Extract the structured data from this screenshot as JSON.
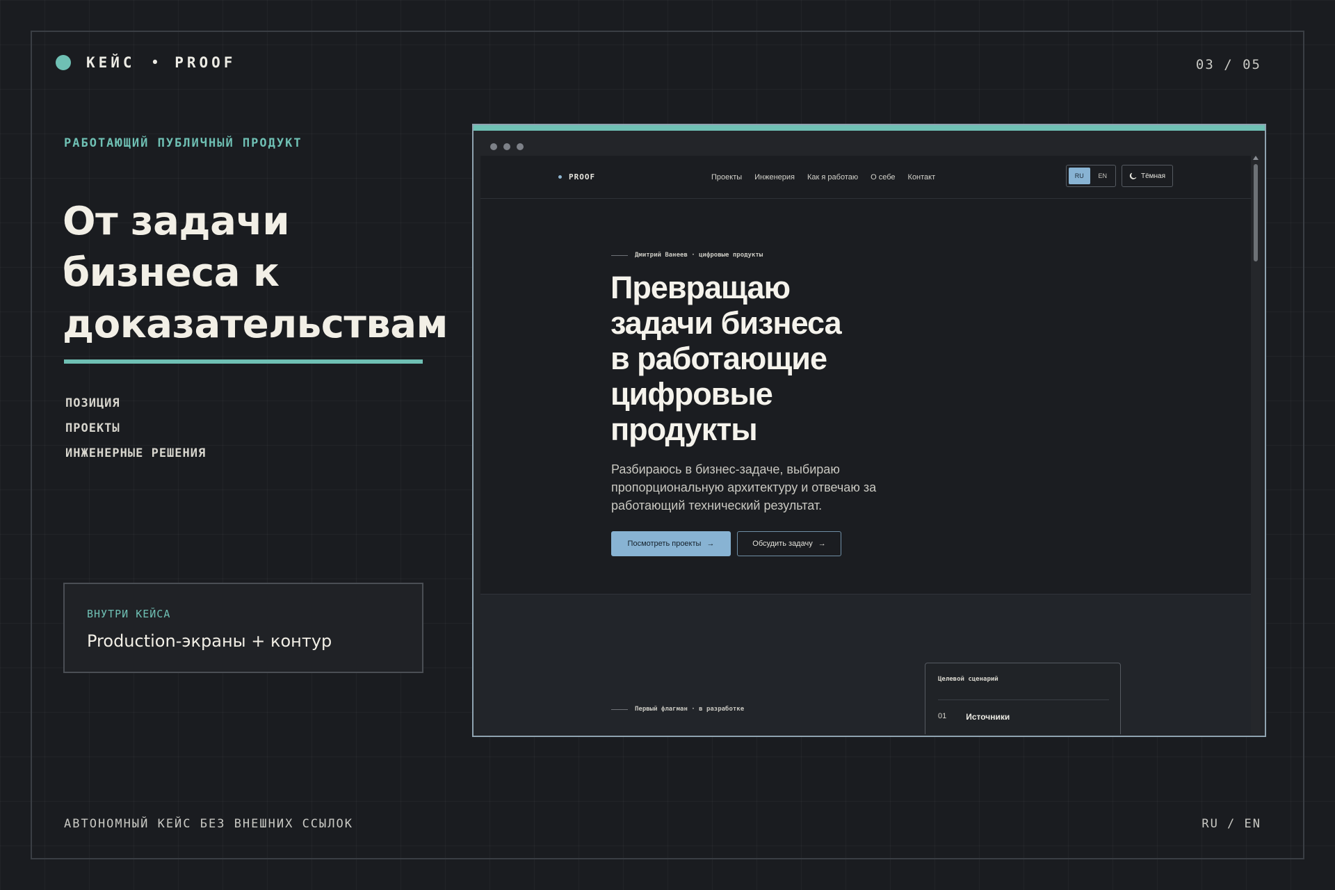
{
  "header": {
    "brand_left": "КЕЙС",
    "brand_sep": "•",
    "brand_right": "PROOF",
    "counter": "03 / 05"
  },
  "intro": {
    "eyebrow": "РАБОТАЮЩИЙ ПУБЛИЧНЫЙ ПРОДУКТ",
    "headline_lines": [
      "От задачи",
      "бизнеса к",
      "доказательствам"
    ],
    "nav_items": [
      "ПОЗИЦИЯ",
      "ПРОЕКТЫ",
      "ИНЖЕНЕРНЫЕ РЕШЕНИЯ"
    ],
    "inside_label": "ВНУТРИ КЕЙСА",
    "inside_value": "Production-экраны + контур"
  },
  "footer": {
    "left": "АВТОНОМНЫЙ КЕЙС БЕЗ ВНЕШНИХ ССЫЛОК",
    "right": "RU / EN"
  },
  "site": {
    "logo": "PROOF",
    "nav": [
      "Проекты",
      "Инженерия",
      "Как я работаю",
      "О себе",
      "Контакт"
    ],
    "lang": [
      "RU",
      "EN"
    ],
    "lang_active": "RU",
    "theme_label": "Тёмная",
    "hero_eyebrow": "Дмитрий Ванеев · цифровые продукты",
    "hero_title_lines": [
      "Превращаю",
      "задачи бизнеса",
      "в работающие",
      "цифровые",
      "продукты"
    ],
    "hero_sub": "Разбираюсь в бизнес-задаче, выбираю пропорциональную архитектуру и отвечаю за работающий технический результат.",
    "btn_primary": "Посмотреть проекты",
    "btn_secondary": "Обсудить задачу",
    "arrow": "→",
    "section2_eyebrow": "Первый флагман · в разработке",
    "card_label": "Целевой сценарий",
    "card_item_num": "01",
    "card_item_value": "Источники"
  },
  "colors": {
    "accent": "#6fc0b4",
    "site_accent": "#88b3d3",
    "background": "#1a1c20"
  },
  "icons": [
    "moon-icon",
    "arrow-right-icon"
  ]
}
